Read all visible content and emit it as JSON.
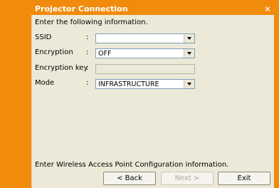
{
  "window": {
    "title": "Projector Connection",
    "close_label": "×"
  },
  "form": {
    "instruction": "Enter the following information.",
    "ssid": {
      "label": "SSID",
      "colon": ":",
      "value": ""
    },
    "encryption": {
      "label": "Encryption",
      "colon": ":",
      "value": "OFF"
    },
    "encryption_key": {
      "label": "Encryption key",
      "colon": ":",
      "value": ""
    },
    "mode": {
      "label": "Mode",
      "colon": ":",
      "value": "INFRASTRUCTURE"
    }
  },
  "footer": {
    "hint": "Enter Wireless Access Point Configuration information.",
    "back_label": "< Back",
    "next_label": "Next >",
    "exit_label": "Exit"
  },
  "colors": {
    "accent": "#f18b0c",
    "panel": "#ece9d8"
  }
}
